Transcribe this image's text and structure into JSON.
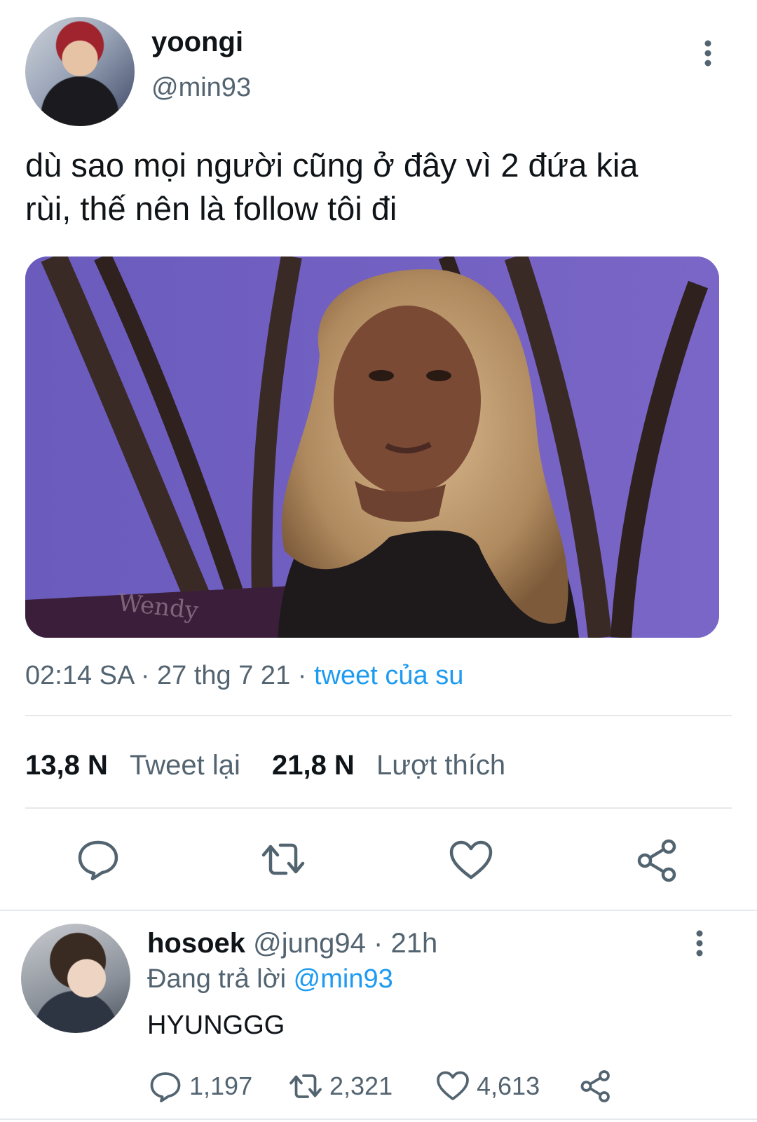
{
  "tweet": {
    "display_name": "yoongi",
    "handle": "@min93",
    "text_line1": "dù sao mọi người cũng ở đây vì 2 đứa kia",
    "text_line2": "rùi, thế nên là follow tôi đi",
    "media_caption": "Wendy",
    "time": "02:14 SA",
    "date": "27 thg 7 21",
    "source": "tweet của su",
    "retweet_count": "13,8 N",
    "retweet_label": "Tweet lại",
    "like_count": "21,8 N",
    "like_label": "Lượt thích"
  },
  "reply": {
    "display_name": "hosoek",
    "handle": "@jung94",
    "age": "21h",
    "replying_label": "Đang trả lời",
    "replying_to": "@min93",
    "text": "HYUNGGG",
    "reply_count": "1,197",
    "retweet_count": "2,321",
    "like_count": "4,613"
  },
  "colors": {
    "text": "#0f1419",
    "secondary": "#536471",
    "link": "#1d9bf0",
    "divider": "#e6e9ec"
  },
  "icons": [
    "more-vertical-icon",
    "reply-icon",
    "retweet-icon",
    "like-icon",
    "share-icon"
  ]
}
